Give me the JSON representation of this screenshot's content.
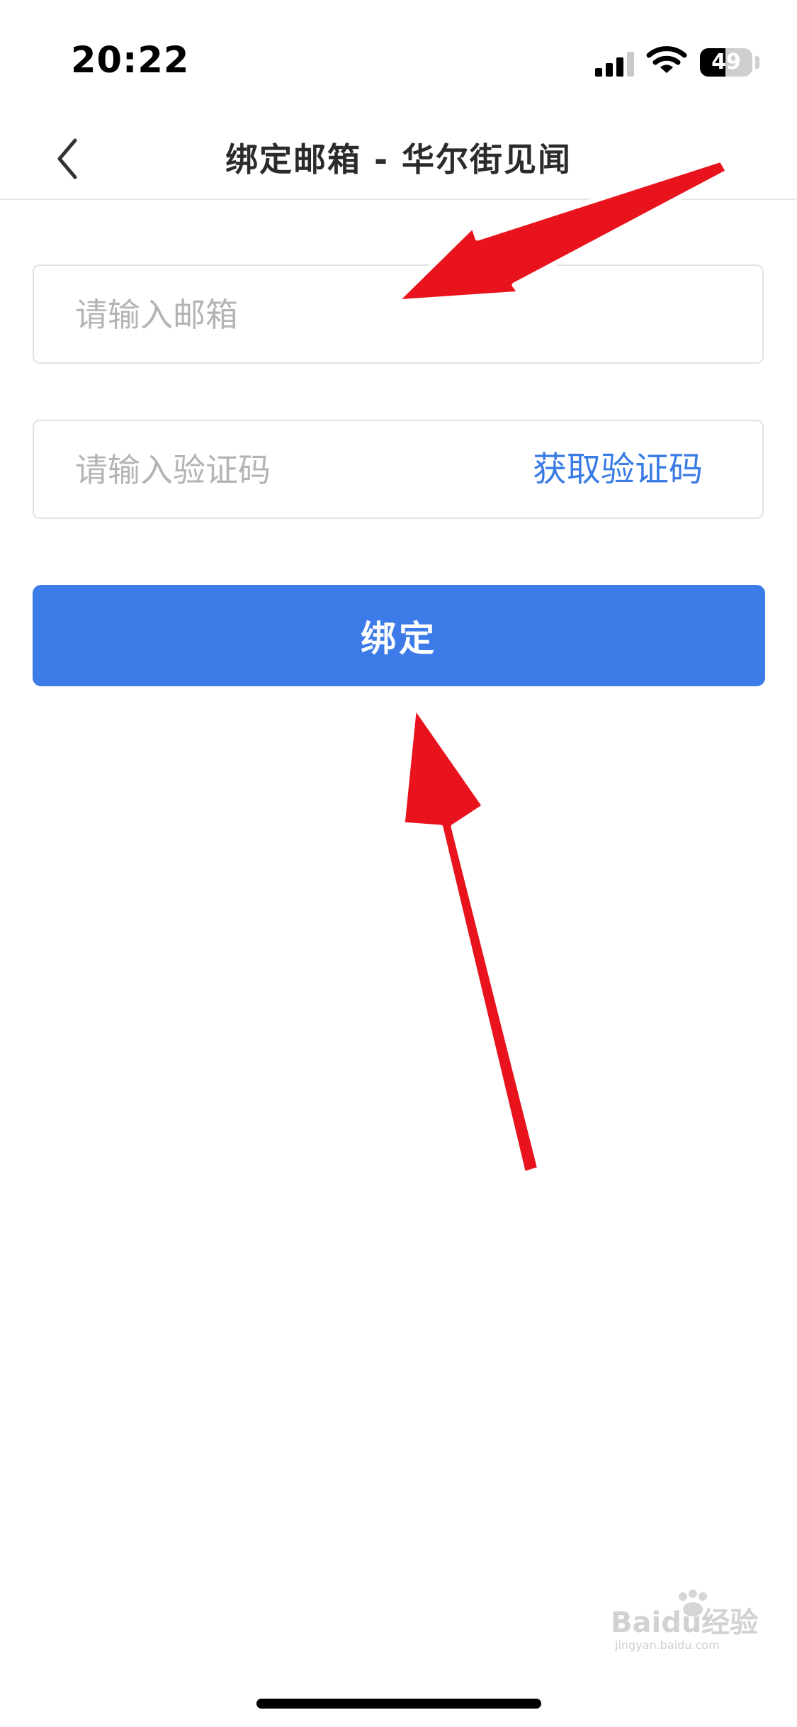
{
  "status_bar": {
    "time": "20:22",
    "battery_level": "49"
  },
  "nav": {
    "title": "绑定邮箱 - 华尔街见闻"
  },
  "form": {
    "email_placeholder": "请输入邮箱",
    "code_placeholder": "请输入验证码",
    "get_code_label": "获取验证码",
    "bind_label": "绑定"
  },
  "watermark": {
    "text": "Baidu经验",
    "subtext": "jingyan.baidu.com"
  },
  "colors": {
    "accent": "#3d7ce8",
    "link": "#3a7be6",
    "annotation_arrow": "#e8131c"
  }
}
